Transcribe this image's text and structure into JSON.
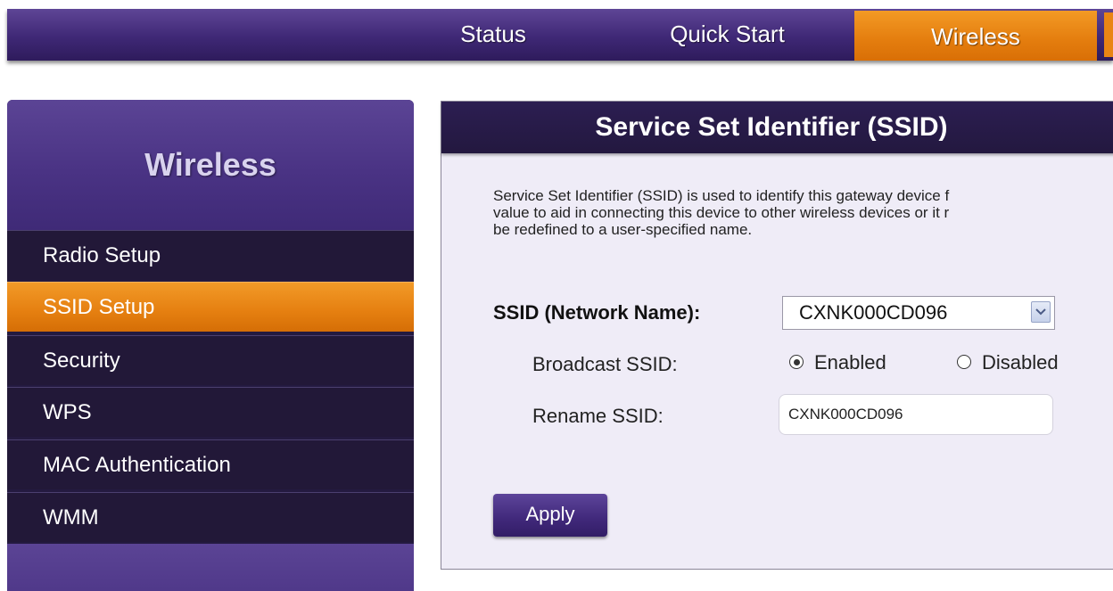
{
  "topnav": {
    "tabs": [
      {
        "label": "Status"
      },
      {
        "label": "Quick Start"
      },
      {
        "label": "Wireless",
        "active": true
      }
    ]
  },
  "sidebar": {
    "title": "Wireless",
    "items": [
      {
        "label": "Radio Setup"
      },
      {
        "label": "SSID Setup",
        "active": true
      },
      {
        "label": "Security"
      },
      {
        "label": "WPS"
      },
      {
        "label": "MAC Authentication"
      },
      {
        "label": "WMM"
      }
    ]
  },
  "main": {
    "title": "Service Set Identifier (SSID)",
    "description_lines": [
      "Service Set Identifier (SSID) is used to identify this gateway device f",
      "value to aid in connecting this device to other wireless devices or it r",
      "be redefined to a user-specified name."
    ],
    "ssid_label": "SSID (Network Name):",
    "ssid_selected": "CXNK000CD096",
    "broadcast_label": "Broadcast SSID:",
    "broadcast_options": [
      "Enabled",
      "Disabled"
    ],
    "broadcast_selected": "Enabled",
    "rename_label": "Rename SSID:",
    "rename_value": "CXNK000CD096",
    "apply_label": "Apply"
  },
  "colors": {
    "nav_purple": "#3f2876",
    "accent_orange": "#e57f10",
    "sidebar_dark": "#221838",
    "panel_bg": "#efecf7"
  }
}
